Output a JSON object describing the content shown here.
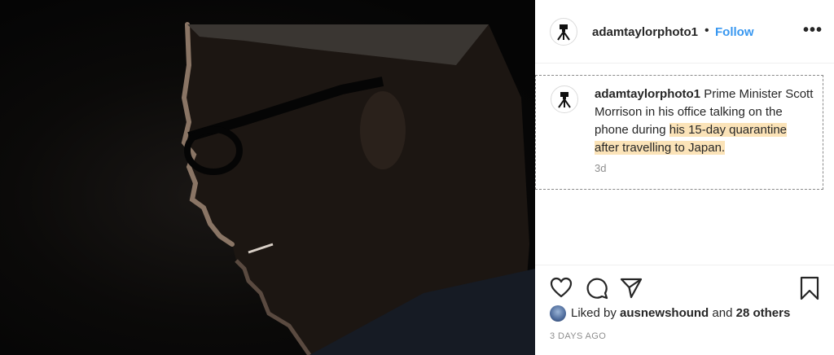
{
  "post": {
    "author": "adamtaylorphoto1",
    "separator": "•",
    "follow_label": "Follow",
    "more_label": "•••"
  },
  "caption": {
    "author": "adamtaylorphoto1",
    "text_plain": " Prime Minister Scott Morrison in his office talking on the phone during ",
    "text_highlight": "his 15-day quarantine after travelling to Japan.",
    "age": "3d"
  },
  "likes": {
    "prefix": "Liked by ",
    "user": "ausnewshound",
    "middle": " and ",
    "others": "28 others"
  },
  "timestamp": "3 DAYS AGO",
  "colors": {
    "follow": "#3897f0",
    "highlight": "#fbe3b8",
    "muted": "#8e8e8e"
  },
  "icons": [
    "heart-icon",
    "comment-icon",
    "share-icon",
    "bookmark-icon",
    "more-icon"
  ]
}
